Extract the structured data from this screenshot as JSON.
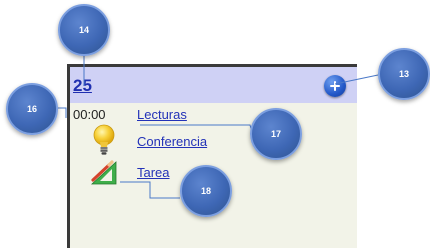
{
  "calendar_cell": {
    "day_number": "25",
    "add_button_icon": "plus-icon",
    "time": "00:00",
    "events": [
      {
        "label": "Lecturas",
        "icon": null
      },
      {
        "label": "Conferencia",
        "icon": "lightbulb-icon"
      },
      {
        "label": "Tarea",
        "icon": "pencil-ruler-icon"
      }
    ]
  },
  "callouts": {
    "c14": "14",
    "c13": "13",
    "c16": "16",
    "c17": "17",
    "c18": "18"
  },
  "colors": {
    "header_bg": "#cfd1f5",
    "cell_bg": "#f2f3e8",
    "link": "#2332b8",
    "badge": "#3e67b5",
    "add_button": "#2358c9"
  }
}
